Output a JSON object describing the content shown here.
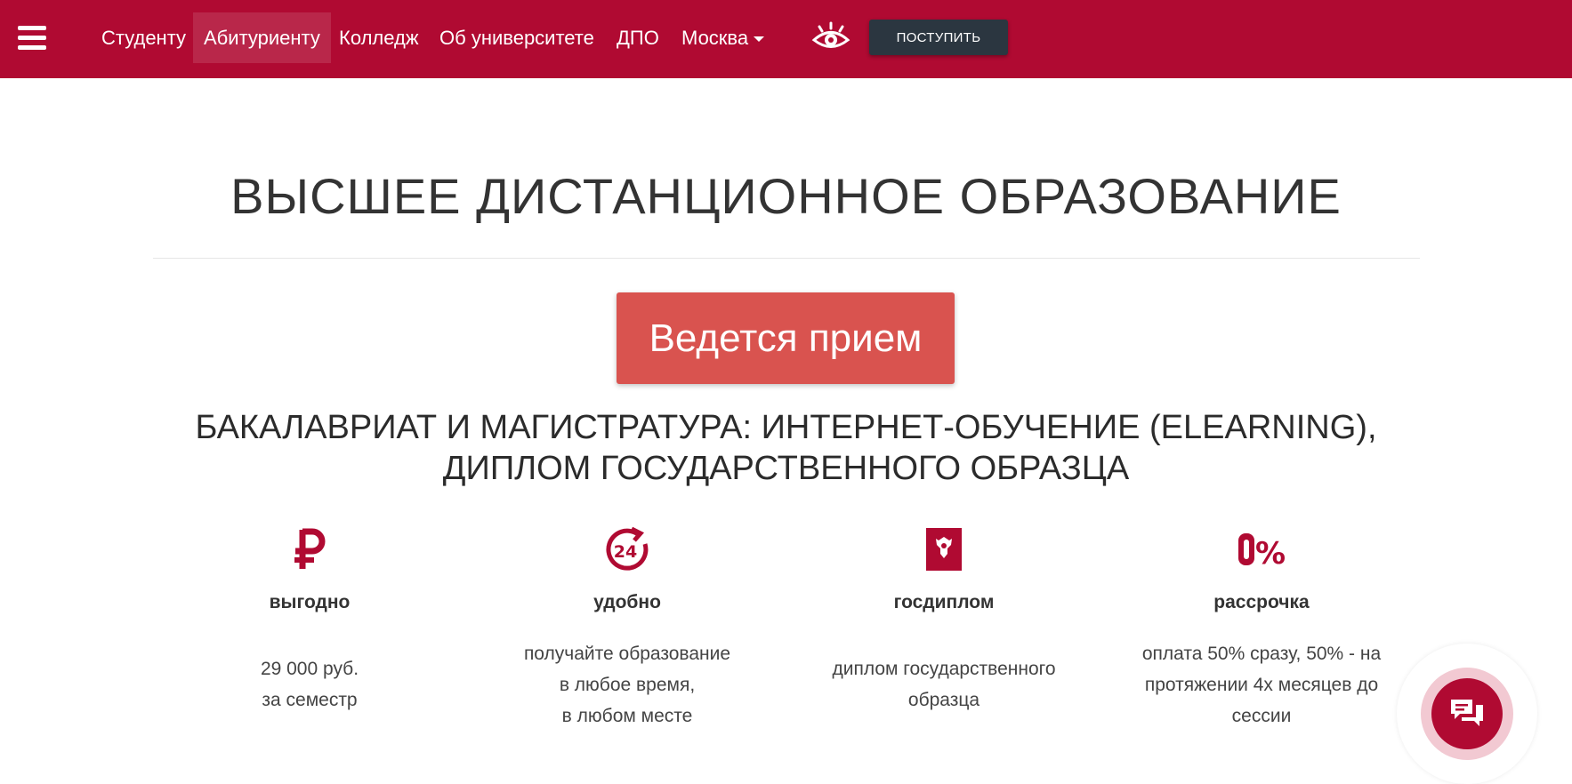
{
  "header": {
    "menu_icon": "hamburger-menu-icon",
    "nav": [
      {
        "label": "Студенту"
      },
      {
        "label": "Абитуриенту",
        "active": true
      },
      {
        "label": "Колледж"
      },
      {
        "label": "Об университете"
      },
      {
        "label": "ДПО"
      },
      {
        "label": "Москва",
        "dropdown": true
      }
    ],
    "accessibility_icon": "eye-icon",
    "cta_label": "ПОСТУПИТЬ"
  },
  "hero": {
    "title": "ВЫСШЕЕ ДИСТАНЦИОННОЕ ОБРАЗОВАНИЕ",
    "admission_button": "Ведется прием",
    "subtitle_line1": "БАКАЛАВРИАТ И МАГИСТРАТУРА: ИНТЕРНЕТ-ОБУЧЕНИЕ (ELEARNING),",
    "subtitle_line2": "ДИПЛОМ ГОСУДАРСТВЕННОГО ОБРАЗЦА"
  },
  "features": [
    {
      "icon": "ruble-icon",
      "title": "выгодно",
      "desc": [
        "29 000 руб.",
        "за семестр"
      ]
    },
    {
      "icon": "clock-24-icon",
      "title": "удобно",
      "desc": [
        "получайте образование",
        "в любое время,",
        "в любом месте"
      ]
    },
    {
      "icon": "state-emblem-diploma-icon",
      "title": "госдиплом",
      "desc": [
        "диплом государственного",
        "образца"
      ]
    },
    {
      "icon": "zero-percent-icon",
      "title": "рассрочка",
      "desc": [
        "оплата 50% сразу, 50% - на",
        "протяжении 4х месяцев до",
        "сессии"
      ]
    }
  ],
  "chat": {
    "icon": "chat-bubbles-icon"
  },
  "colors": {
    "brand": "#b00a32",
    "admission": "#d9534f",
    "cta": "#2b3640"
  }
}
